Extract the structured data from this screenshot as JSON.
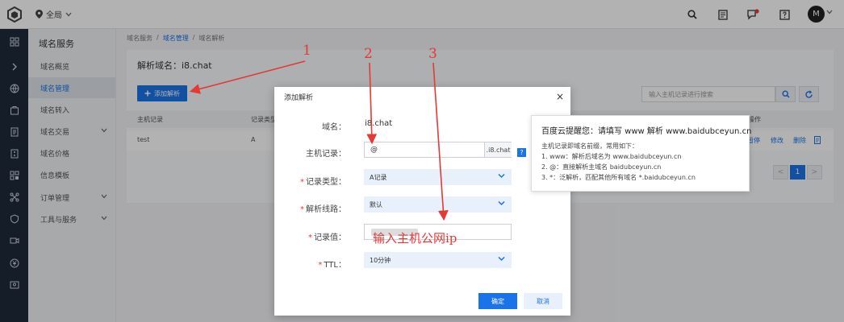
{
  "topbar": {
    "region": "全局",
    "avatar": "M",
    "icons": [
      "search-icon",
      "document-icon",
      "message-icon",
      "help-icon"
    ],
    "accent": "#1a73e8"
  },
  "rail": {
    "icons": [
      "grid-icon",
      "expand-icon",
      "globe-icon",
      "box-icon",
      "file-icon",
      "server-icon",
      "layers-icon",
      "network-icon",
      "shield-icon",
      "video-icon",
      "coin-icon",
      "id-icon"
    ]
  },
  "sidebar": {
    "title": "域名服务",
    "items": [
      {
        "label": "域名概览"
      },
      {
        "label": "域名管理"
      },
      {
        "label": "域名转入"
      },
      {
        "label": "域名交易"
      },
      {
        "label": "域名价格"
      },
      {
        "label": "信息模板"
      },
      {
        "label": "订单管理"
      },
      {
        "label": "工具与服务"
      }
    ]
  },
  "breadcrumb": {
    "items": [
      "域名服务",
      "域名管理",
      "域名解析"
    ],
    "sep": "/"
  },
  "main": {
    "title": "解析域名：i8.chat",
    "add_button": "添加解析",
    "search_placeholder": "输入主机记录进行搜索",
    "table": {
      "headers": [
        "主机记录",
        "记录类型",
        "操作"
      ],
      "rows": [
        {
          "host": "test",
          "type": "A",
          "ops": [
            "暂停",
            "修改",
            "删除"
          ]
        }
      ]
    },
    "pager": {
      "prev": "<",
      "current": "1",
      "next": ">"
    }
  },
  "modal": {
    "title": "添加解析",
    "close": "×",
    "domain_label": "域名：",
    "domain_value": "i8.chat",
    "host_label": "主机记录：",
    "host_value": "@",
    "host_suffix": ".i8.chat",
    "help": "?",
    "required_mark": "*",
    "type_label": "记录类型：",
    "type_value": "A记录",
    "line_label": "解析线路：",
    "line_value": "默认",
    "value_label": "记录值：",
    "value_hint": "输入主机公网ip",
    "ttl_label": "TTL：",
    "ttl_value": "10分钟",
    "ok": "确定",
    "cancel": "取消"
  },
  "tooltip": {
    "title": "百度云提醒您：请填写 www 解析 www.baidubceyun.cn",
    "lines": [
      "主机记录即域名前缀，常用如下：",
      "1. www：解析后域名为 www.baidubceyun.cn",
      "2. @：直接解析主域名 baidubceyun.cn",
      "3. *：泛解析，匹配其他所有域名 *.baidubceyun.cn"
    ]
  },
  "annotations": {
    "numbers": [
      "1",
      "2",
      "3"
    ],
    "color": "#e53935"
  }
}
